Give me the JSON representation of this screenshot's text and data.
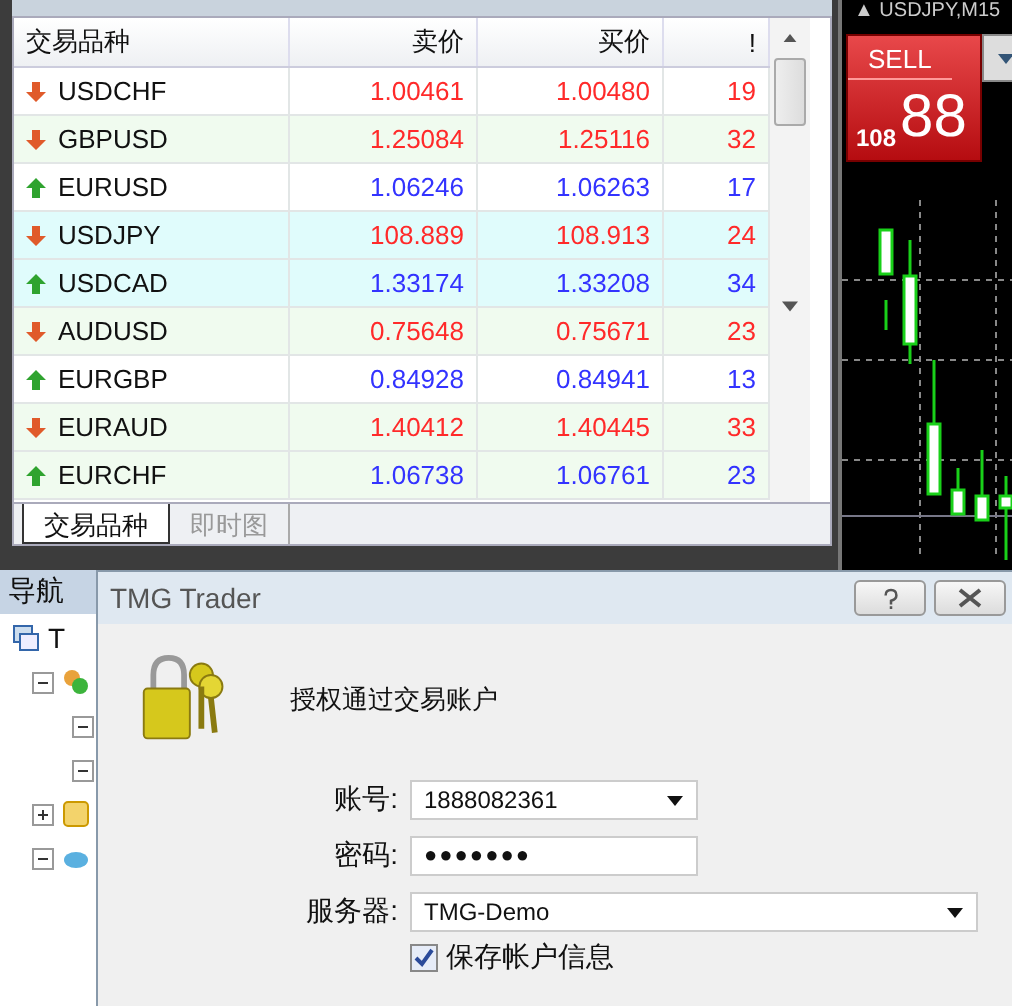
{
  "market_watch": {
    "columns": [
      "交易品种",
      "卖价",
      "买价",
      "!"
    ],
    "rows": [
      {
        "symbol": "USDCHF",
        "kind": "down",
        "color": "#ffffff",
        "bid": "1.00461",
        "ask": "1.00480",
        "spread": "19"
      },
      {
        "symbol": "GBPUSD",
        "kind": "down",
        "color": "#f0fbef",
        "bid": "1.25084",
        "ask": "1.25116",
        "spread": "32"
      },
      {
        "symbol": "EURUSD",
        "kind": "up",
        "color": "#ffffff",
        "bid": "1.06246",
        "ask": "1.06263",
        "spread": "17"
      },
      {
        "symbol": "USDJPY",
        "kind": "down",
        "color": "#e0fcfc",
        "bid": "108.889",
        "ask": "108.913",
        "spread": "24"
      },
      {
        "symbol": "USDCAD",
        "kind": "up",
        "color": "#e0fcfc",
        "bid": "1.33174",
        "ask": "1.33208",
        "spread": "34"
      },
      {
        "symbol": "AUDUSD",
        "kind": "down",
        "color": "#f0fbef",
        "bid": "0.75648",
        "ask": "0.75671",
        "spread": "23"
      },
      {
        "symbol": "EURGBP",
        "kind": "up",
        "color": "#ffffff",
        "bid": "0.84928",
        "ask": "0.84941",
        "spread": "13"
      },
      {
        "symbol": "EURAUD",
        "kind": "down",
        "color": "#f0fbef",
        "bid": "1.40412",
        "ask": "1.40445",
        "spread": "33"
      },
      {
        "symbol": "EURCHF",
        "kind": "up",
        "color": "#f0fbef",
        "bid": "1.06738",
        "ask": "1.06761",
        "spread": "23"
      }
    ],
    "tabs": [
      {
        "label": "交易品种",
        "selected": true
      },
      {
        "label": "即时图",
        "selected": false
      }
    ]
  },
  "chart": {
    "title": "▲ USDJPY,M15",
    "sell_label": "SELL",
    "price_small": "108",
    "price_big": "88"
  },
  "navigator": {
    "title": "导航",
    "root_label": "T",
    "nodes": [
      {
        "expanded": true
      },
      {
        "expanded": true
      },
      {
        "expanded": true
      },
      {
        "expanded": false
      },
      {
        "expanded": true
      }
    ]
  },
  "dialog": {
    "title": "TMG Trader",
    "message": "授权通过交易账户",
    "fields": [
      {
        "label": "账号:",
        "kind": "combo",
        "value": "1888082361"
      },
      {
        "label": "密码:",
        "kind": "password",
        "value": "●●●●●●●"
      },
      {
        "label": "服务器:",
        "kind": "combo-wide",
        "value": "TMG-Demo"
      }
    ],
    "save_info": {
      "label": "保存帐户信息",
      "checked": true
    }
  }
}
